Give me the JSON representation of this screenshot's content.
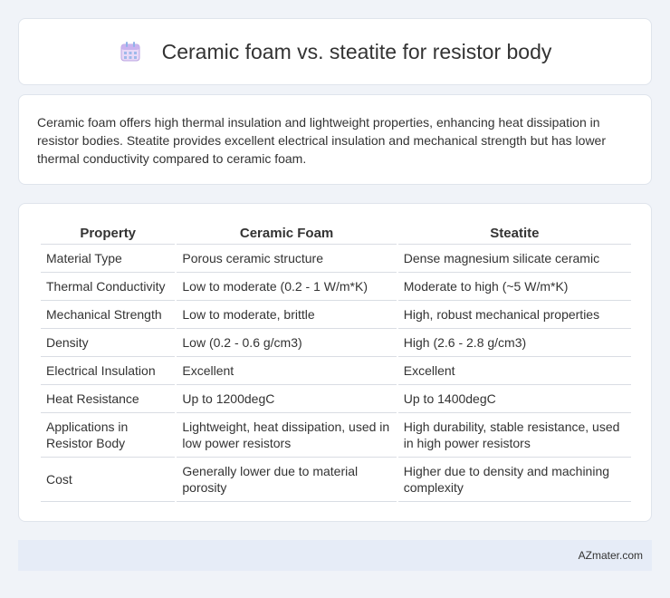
{
  "header": {
    "title": "Ceramic foam vs. steatite for resistor body",
    "icon": "calendar-icon"
  },
  "description": "Ceramic foam offers high thermal insulation and lightweight properties, enhancing heat dissipation in resistor bodies. Steatite provides excellent electrical insulation and mechanical strength but has lower thermal conductivity compared to ceramic foam.",
  "table": {
    "headers": [
      "Property",
      "Ceramic Foam",
      "Steatite"
    ],
    "rows": [
      [
        "Material Type",
        "Porous ceramic structure",
        "Dense magnesium silicate ceramic"
      ],
      [
        "Thermal Conductivity",
        "Low to moderate (0.2 - 1 W/m*K)",
        "Moderate to high (~5 W/m*K)"
      ],
      [
        "Mechanical Strength",
        "Low to moderate, brittle",
        "High, robust mechanical properties"
      ],
      [
        "Density",
        "Low (0.2 - 0.6 g/cm3)",
        "High (2.6 - 2.8 g/cm3)"
      ],
      [
        "Electrical Insulation",
        "Excellent",
        "Excellent"
      ],
      [
        "Heat Resistance",
        "Up to 1200degC",
        "Up to 1400degC"
      ],
      [
        "Applications in Resistor Body",
        "Lightweight, heat dissipation, used in low power resistors",
        "High durability, stable resistance, used in high power resistors"
      ],
      [
        "Cost",
        "Generally lower due to material porosity",
        "Higher due to density and machining complexity"
      ]
    ]
  },
  "footer": {
    "brand": "AZmater.com"
  }
}
